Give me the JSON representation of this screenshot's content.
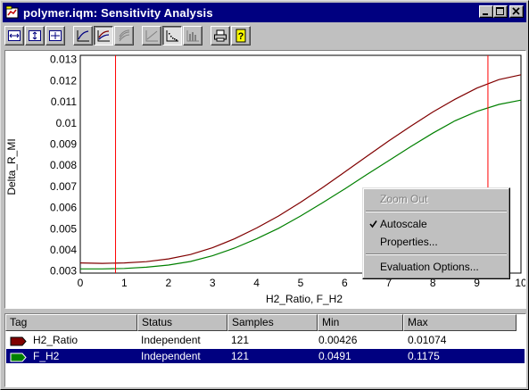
{
  "window": {
    "title": "polymer.iqm: Sensitivity Analysis"
  },
  "title_buttons": {
    "minimize": "_",
    "maximize": "□",
    "close": "✕"
  },
  "toolbar": {
    "icons": [
      "fit-width-icon",
      "fit-height-icon",
      "fit-all-icon",
      "line-curve-icon",
      "multi-curve-icon",
      "surface-curve-icon",
      "line-plot-icon",
      "scatter-plot-icon",
      "bar-plot-icon",
      "print-icon",
      "help-icon"
    ],
    "pressed": [
      "multi-curve-icon",
      "scatter-plot-icon"
    ]
  },
  "chart_data": {
    "type": "line",
    "xlabel": "H2_Ratio, F_H2",
    "ylabel": "Delta_R_MI",
    "xlim": [
      0,
      10
    ],
    "ylim": [
      0.0029,
      0.0132
    ],
    "x_ticks": [
      "0",
      "1",
      "2",
      "3",
      "4",
      "5",
      "6",
      "7",
      "8",
      "9",
      "10"
    ],
    "y_ticks": [
      "0.003",
      "0.004",
      "0.005",
      "0.006",
      "0.007",
      "0.008",
      "0.009",
      "0.01",
      "0.011",
      "0.012",
      "0.013"
    ],
    "y_tick_values": [
      0.003,
      0.004,
      0.005,
      0.006,
      0.007,
      0.008,
      0.009,
      0.01,
      0.011,
      0.012,
      0.013
    ],
    "x": [
      0,
      0.5,
      1,
      1.5,
      2,
      2.5,
      3,
      3.5,
      4,
      4.5,
      5,
      5.5,
      6,
      6.5,
      7,
      7.5,
      8,
      8.5,
      9,
      9.5,
      10
    ],
    "series": [
      {
        "name": "H2_Ratio",
        "color": "#800000",
        "values": [
          0.00338,
          0.00336,
          0.00338,
          0.00344,
          0.00357,
          0.00378,
          0.0041,
          0.00452,
          0.00503,
          0.0056,
          0.00625,
          0.00695,
          0.00768,
          0.00842,
          0.00915,
          0.00985,
          0.01052,
          0.01112,
          0.01165,
          0.01205,
          0.01228
        ]
      },
      {
        "name": "F_H2",
        "color": "#008000",
        "values": [
          0.0031,
          0.0031,
          0.00312,
          0.00318,
          0.00328,
          0.00345,
          0.00372,
          0.00408,
          0.00452,
          0.00502,
          0.0056,
          0.00623,
          0.00688,
          0.00756,
          0.00822,
          0.00888,
          0.00952,
          0.0101,
          0.01055,
          0.01088,
          0.01108
        ]
      }
    ],
    "markers": [
      {
        "x": 0.8,
        "color": "#ff0000"
      },
      {
        "x": 9.25,
        "color": "#ff0000"
      }
    ],
    "grid": false,
    "legend": "none"
  },
  "context_menu": {
    "items": [
      {
        "label": "Zoom Out",
        "disabled": true,
        "checked": false
      },
      {
        "separator": true
      },
      {
        "label": "Autoscale",
        "disabled": false,
        "checked": true
      },
      {
        "label": "Properties...",
        "disabled": false,
        "checked": false
      },
      {
        "separator": true
      },
      {
        "label": "Evaluation Options...",
        "disabled": false,
        "checked": false
      }
    ]
  },
  "table": {
    "columns": [
      "Tag",
      "Status",
      "Samples",
      "Min",
      "Max"
    ],
    "rows": [
      {
        "tag": "H2_Ratio",
        "status": "Independent",
        "samples": "121",
        "min": "0.00426",
        "max": "0.01074",
        "color": "#800000",
        "selected": false
      },
      {
        "tag": "F_H2",
        "status": "Independent",
        "samples": "121",
        "min": "0.0491",
        "max": "0.1175",
        "color": "#008000",
        "selected": true
      }
    ]
  }
}
